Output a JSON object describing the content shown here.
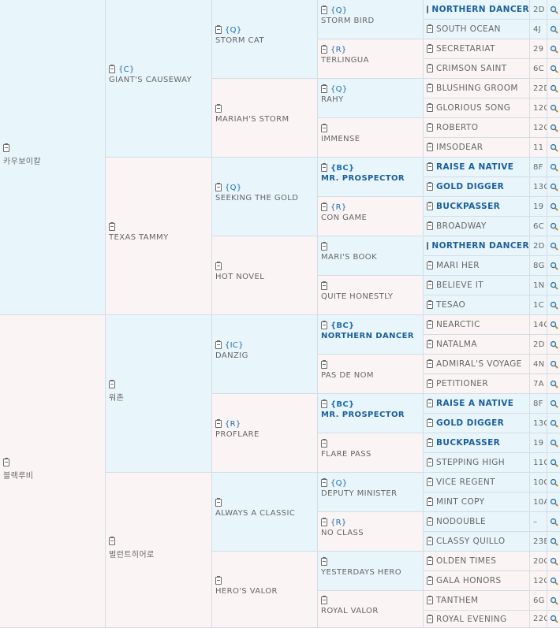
{
  "col1": [
    {
      "name": "카우보이칼"
    },
    {
      "name": "블랙루비"
    }
  ],
  "col2": [
    {
      "tag": "{C}",
      "name": "GIANT'S CAUSEWAY"
    },
    {
      "tag": "",
      "name": "TEXAS TAMMY"
    },
    {
      "tag": "",
      "name": "워존"
    },
    {
      "tag": "",
      "name": "벌런트히어로"
    }
  ],
  "col3": [
    {
      "tag": "{Q}",
      "name": "STORM CAT"
    },
    {
      "tag": "",
      "name": "MARIAH'S STORM"
    },
    {
      "tag": "{Q}",
      "name": "SEEKING THE GOLD"
    },
    {
      "tag": "",
      "name": "HOT NOVEL"
    },
    {
      "tag": "{IC}",
      "name": "DANZIG"
    },
    {
      "tag": "{R}",
      "name": "PROFLARE"
    },
    {
      "tag": "",
      "name": "ALWAYS A CLASSIC"
    },
    {
      "tag": "",
      "name": "HERO'S VALOR"
    }
  ],
  "col4": [
    {
      "tag": "{Q}",
      "name": "STORM BIRD"
    },
    {
      "tag": "{R}",
      "name": "TERLINGUA"
    },
    {
      "tag": "{Q}",
      "name": "RAHY"
    },
    {
      "tag": "",
      "name": "IMMENSE"
    },
    {
      "tag": "{BC}",
      "name": "MR. PROSPECTOR"
    },
    {
      "tag": "{R}",
      "name": "CON GAME"
    },
    {
      "tag": "",
      "name": "MARI'S BOOK"
    },
    {
      "tag": "",
      "name": "QUITE HONESTLY"
    },
    {
      "tag": "{BC}",
      "name": "NORTHERN DANCER"
    },
    {
      "tag": "",
      "name": "PAS DE NOM"
    },
    {
      "tag": "{BC}",
      "name": "MR. PROSPECTOR"
    },
    {
      "tag": "",
      "name": "FLARE PASS"
    },
    {
      "tag": "{Q}",
      "name": "DEPUTY MINISTER"
    },
    {
      "tag": "{R}",
      "name": "NO CLASS"
    },
    {
      "tag": "",
      "name": "YESTERDAYS HERO"
    },
    {
      "tag": "",
      "name": "ROYAL VALOR"
    }
  ],
  "col5": [
    {
      "name": "NORTHERN DANCER",
      "code": "2D"
    },
    {
      "name": "SOUTH OCEAN",
      "code": "4J"
    },
    {
      "name": "SECRETARIAT",
      "code": "29"
    },
    {
      "name": "CRIMSON SAINT",
      "code": "6C"
    },
    {
      "name": "BLUSHING GROOM",
      "code": "22D"
    },
    {
      "name": "GLORIOUS SONG",
      "code": "12C"
    },
    {
      "name": "ROBERTO",
      "code": "12C"
    },
    {
      "name": "IMSODEAR",
      "code": "11"
    },
    {
      "name": "RAISE A NATIVE",
      "code": "8F"
    },
    {
      "name": "GOLD DIGGER",
      "code": "13C"
    },
    {
      "name": "BUCKPASSER",
      "code": "19"
    },
    {
      "name": "BROADWAY",
      "code": "6C"
    },
    {
      "name": "NORTHERN DANCER",
      "code": "2D"
    },
    {
      "name": "MARI HER",
      "code": "8G"
    },
    {
      "name": "BELIEVE IT",
      "code": "1N"
    },
    {
      "name": "TESAO",
      "code": "1C"
    },
    {
      "name": "NEARCTIC",
      "code": "14C"
    },
    {
      "name": "NATALMA",
      "code": "2D"
    },
    {
      "name": "ADMIRAL'S VOYAGE",
      "code": "4N"
    },
    {
      "name": "PETITIONER",
      "code": "7A"
    },
    {
      "name": "RAISE A NATIVE",
      "code": "8F"
    },
    {
      "name": "GOLD DIGGER",
      "code": "13C"
    },
    {
      "name": "BUCKPASSER",
      "code": "19"
    },
    {
      "name": "STEPPING HIGH",
      "code": "11C"
    },
    {
      "name": "VICE REGENT",
      "code": "10C"
    },
    {
      "name": "MINT COPY",
      "code": "10A"
    },
    {
      "name": "NODOUBLE",
      "code": "–"
    },
    {
      "name": "CLASSY QUILLO",
      "code": "23B"
    },
    {
      "name": "OLDEN TIMES",
      "code": "20C"
    },
    {
      "name": "GALA HONORS",
      "code": "12C"
    },
    {
      "name": "TANTHEM",
      "code": "6G"
    },
    {
      "name": "ROYAL EVENING",
      "code": "22C"
    }
  ],
  "colors": {
    "blue": "#e8f5fb",
    "pink": "#fbf4f4",
    "tag": "#1f6fb2",
    "bold_name": "#1b5f9c",
    "border": "#d4dde3"
  },
  "icons": {
    "doc": "clipboard-icon",
    "search": "magnifier-icon"
  }
}
